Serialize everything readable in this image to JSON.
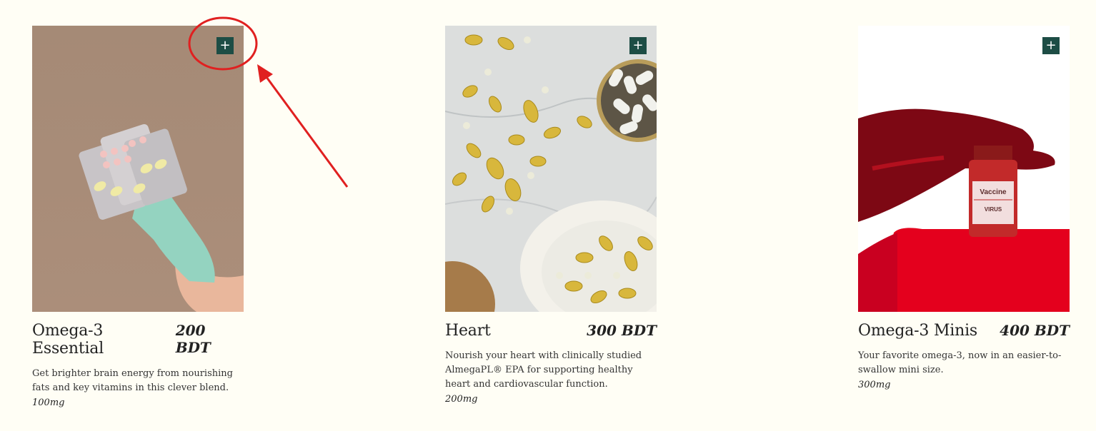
{
  "products": [
    {
      "name": "Omega-3 Essential",
      "price": "200 BDT",
      "description": "Get brighter brain energy from nourishing fats and key vitamins in this clever blend.",
      "size": "100mg",
      "add_icon": "plus-icon"
    },
    {
      "name": "Heart",
      "price": "300 BDT",
      "description": "Nourish your heart with clinically studied AlmegaPL® EPA for supporting healthy heart and cardiovascular function.",
      "size": "200mg",
      "add_icon": "plus-icon"
    },
    {
      "name": "Omega-3 Minis",
      "price": "400 BDT",
      "description": "Your favorite omega-3, now in an easier-to-swallow mini size.",
      "size": "300mg",
      "add_icon": "plus-icon"
    }
  ],
  "vial_labels": {
    "top": "Vaccine",
    "bottom": "VIRUS"
  },
  "colors": {
    "background": "#fffef5",
    "button": "#1d4d45",
    "annotation": "#e02020"
  }
}
